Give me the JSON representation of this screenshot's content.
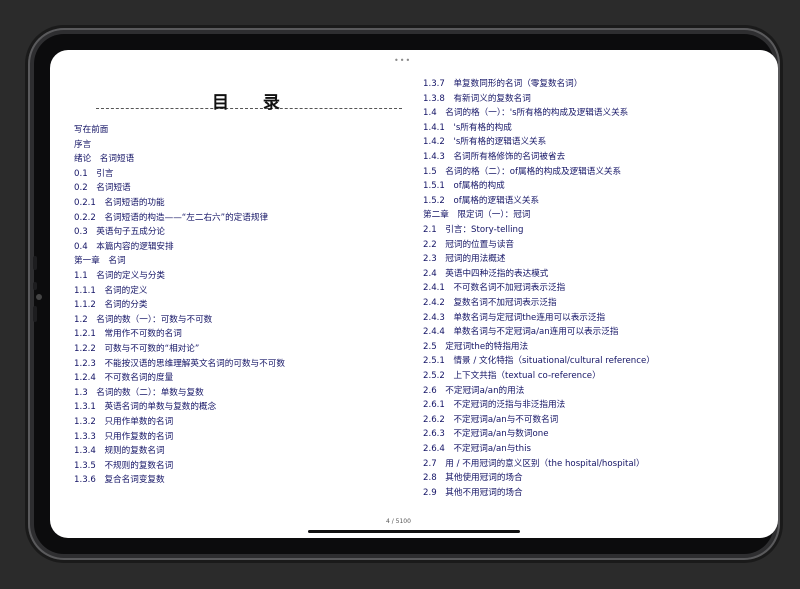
{
  "header": {
    "menu_dots": "•••"
  },
  "toc_title": "目 录",
  "left_entries": [
    "写在前面",
    "序言",
    "绪论　名词短语",
    "0.1　引言",
    "0.2　名词短语",
    "0.2.1　名词短语的功能",
    "0.2.2　名词短语的构造——“左二右六”的定语规律",
    "0.3　英语句子五成分论",
    "0.4　本篇内容的逻辑安排",
    "第一章　名词",
    "1.1　名词的定义与分类",
    "1.1.1　名词的定义",
    "1.1.2　名词的分类",
    "1.2　名词的数（一）：可数与不可数",
    "1.2.1　常用作不可数的名词",
    "1.2.2　可数与不可数的“相对论”",
    "1.2.3　不能按汉语的思维理解英文名词的可数与不可数",
    "1.2.4　不可数名词的度量",
    "1.3　名词的数（二）：单数与复数",
    "1.3.1　英语名词的单数与复数的概念",
    "1.3.2　只用作单数的名词",
    "1.3.3　只用作复数的名词",
    "1.3.4　规则的复数名词",
    "1.3.5　不规则的复数名词",
    "1.3.6　复合名词变复数"
  ],
  "right_entries": [
    "1.3.7　单复数同形的名词（零复数名词）",
    "1.3.8　有新词义的复数名词",
    "1.4　名词的格（一）：'s所有格的构成及逻辑语义关系",
    "1.4.1　's所有格的构成",
    "1.4.2　's所有格的逻辑语义关系",
    "1.4.3　名词所有格修饰的名词被省去",
    "1.5　名词的格（二）：of属格的构成及逻辑语义关系",
    "1.5.1　of属格的构成",
    "1.5.2　of属格的逻辑语义关系",
    "第二章　限定词（一）：冠词",
    "2.1　引言：Story-telling",
    "2.2　冠词的位置与读音",
    "2.3　冠词的用法概述",
    "2.4　英语中四种泛指的表达模式",
    "2.4.1　不可数名词不加冠词表示泛指",
    "2.4.2　复数名词不加冠词表示泛指",
    "2.4.3　单数名词与定冠词the连用可以表示泛指",
    "2.4.4　单数名词与不定冠词a/an连用可以表示泛指",
    "2.5　定冠词the的特指用法",
    "2.5.1　情景 / 文化特指（situational/cultural reference）",
    "2.5.2　上下文共指（textual co-reference）",
    "2.6　不定冠词a/an的用法",
    "2.6.1　不定冠词的泛指与非泛指用法",
    "2.6.2　不定冠词a/an与不可数名词",
    "2.6.3　不定冠词a/an与数词one",
    "2.6.4　不定冠词a/an与this",
    "2.7　用 / 不用冠词的意义区别（the hospital/hospital）",
    "2.8　其他使用冠词的场合",
    "2.9　其他不用冠词的场合"
  ],
  "footer": {
    "page_indicator": "4 / 5100"
  }
}
